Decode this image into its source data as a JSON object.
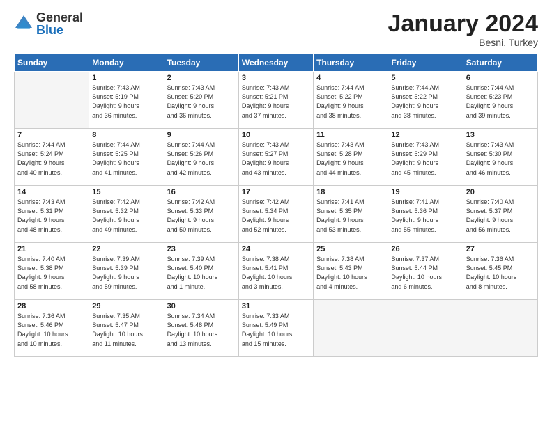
{
  "logo": {
    "general": "General",
    "blue": "Blue"
  },
  "title": "January 2024",
  "subtitle": "Besni, Turkey",
  "days_header": [
    "Sunday",
    "Monday",
    "Tuesday",
    "Wednesday",
    "Thursday",
    "Friday",
    "Saturday"
  ],
  "weeks": [
    [
      {
        "num": "",
        "info": ""
      },
      {
        "num": "1",
        "info": "Sunrise: 7:43 AM\nSunset: 5:19 PM\nDaylight: 9 hours\nand 36 minutes."
      },
      {
        "num": "2",
        "info": "Sunrise: 7:43 AM\nSunset: 5:20 PM\nDaylight: 9 hours\nand 36 minutes."
      },
      {
        "num": "3",
        "info": "Sunrise: 7:43 AM\nSunset: 5:21 PM\nDaylight: 9 hours\nand 37 minutes."
      },
      {
        "num": "4",
        "info": "Sunrise: 7:44 AM\nSunset: 5:22 PM\nDaylight: 9 hours\nand 38 minutes."
      },
      {
        "num": "5",
        "info": "Sunrise: 7:44 AM\nSunset: 5:22 PM\nDaylight: 9 hours\nand 38 minutes."
      },
      {
        "num": "6",
        "info": "Sunrise: 7:44 AM\nSunset: 5:23 PM\nDaylight: 9 hours\nand 39 minutes."
      }
    ],
    [
      {
        "num": "7",
        "info": "Sunrise: 7:44 AM\nSunset: 5:24 PM\nDaylight: 9 hours\nand 40 minutes."
      },
      {
        "num": "8",
        "info": "Sunrise: 7:44 AM\nSunset: 5:25 PM\nDaylight: 9 hours\nand 41 minutes."
      },
      {
        "num": "9",
        "info": "Sunrise: 7:44 AM\nSunset: 5:26 PM\nDaylight: 9 hours\nand 42 minutes."
      },
      {
        "num": "10",
        "info": "Sunrise: 7:43 AM\nSunset: 5:27 PM\nDaylight: 9 hours\nand 43 minutes."
      },
      {
        "num": "11",
        "info": "Sunrise: 7:43 AM\nSunset: 5:28 PM\nDaylight: 9 hours\nand 44 minutes."
      },
      {
        "num": "12",
        "info": "Sunrise: 7:43 AM\nSunset: 5:29 PM\nDaylight: 9 hours\nand 45 minutes."
      },
      {
        "num": "13",
        "info": "Sunrise: 7:43 AM\nSunset: 5:30 PM\nDaylight: 9 hours\nand 46 minutes."
      }
    ],
    [
      {
        "num": "14",
        "info": "Sunrise: 7:43 AM\nSunset: 5:31 PM\nDaylight: 9 hours\nand 48 minutes."
      },
      {
        "num": "15",
        "info": "Sunrise: 7:42 AM\nSunset: 5:32 PM\nDaylight: 9 hours\nand 49 minutes."
      },
      {
        "num": "16",
        "info": "Sunrise: 7:42 AM\nSunset: 5:33 PM\nDaylight: 9 hours\nand 50 minutes."
      },
      {
        "num": "17",
        "info": "Sunrise: 7:42 AM\nSunset: 5:34 PM\nDaylight: 9 hours\nand 52 minutes."
      },
      {
        "num": "18",
        "info": "Sunrise: 7:41 AM\nSunset: 5:35 PM\nDaylight: 9 hours\nand 53 minutes."
      },
      {
        "num": "19",
        "info": "Sunrise: 7:41 AM\nSunset: 5:36 PM\nDaylight: 9 hours\nand 55 minutes."
      },
      {
        "num": "20",
        "info": "Sunrise: 7:40 AM\nSunset: 5:37 PM\nDaylight: 9 hours\nand 56 minutes."
      }
    ],
    [
      {
        "num": "21",
        "info": "Sunrise: 7:40 AM\nSunset: 5:38 PM\nDaylight: 9 hours\nand 58 minutes."
      },
      {
        "num": "22",
        "info": "Sunrise: 7:39 AM\nSunset: 5:39 PM\nDaylight: 9 hours\nand 59 minutes."
      },
      {
        "num": "23",
        "info": "Sunrise: 7:39 AM\nSunset: 5:40 PM\nDaylight: 10 hours\nand 1 minute."
      },
      {
        "num": "24",
        "info": "Sunrise: 7:38 AM\nSunset: 5:41 PM\nDaylight: 10 hours\nand 3 minutes."
      },
      {
        "num": "25",
        "info": "Sunrise: 7:38 AM\nSunset: 5:43 PM\nDaylight: 10 hours\nand 4 minutes."
      },
      {
        "num": "26",
        "info": "Sunrise: 7:37 AM\nSunset: 5:44 PM\nDaylight: 10 hours\nand 6 minutes."
      },
      {
        "num": "27",
        "info": "Sunrise: 7:36 AM\nSunset: 5:45 PM\nDaylight: 10 hours\nand 8 minutes."
      }
    ],
    [
      {
        "num": "28",
        "info": "Sunrise: 7:36 AM\nSunset: 5:46 PM\nDaylight: 10 hours\nand 10 minutes."
      },
      {
        "num": "29",
        "info": "Sunrise: 7:35 AM\nSunset: 5:47 PM\nDaylight: 10 hours\nand 11 minutes."
      },
      {
        "num": "30",
        "info": "Sunrise: 7:34 AM\nSunset: 5:48 PM\nDaylight: 10 hours\nand 13 minutes."
      },
      {
        "num": "31",
        "info": "Sunrise: 7:33 AM\nSunset: 5:49 PM\nDaylight: 10 hours\nand 15 minutes."
      },
      {
        "num": "",
        "info": ""
      },
      {
        "num": "",
        "info": ""
      },
      {
        "num": "",
        "info": ""
      }
    ]
  ]
}
